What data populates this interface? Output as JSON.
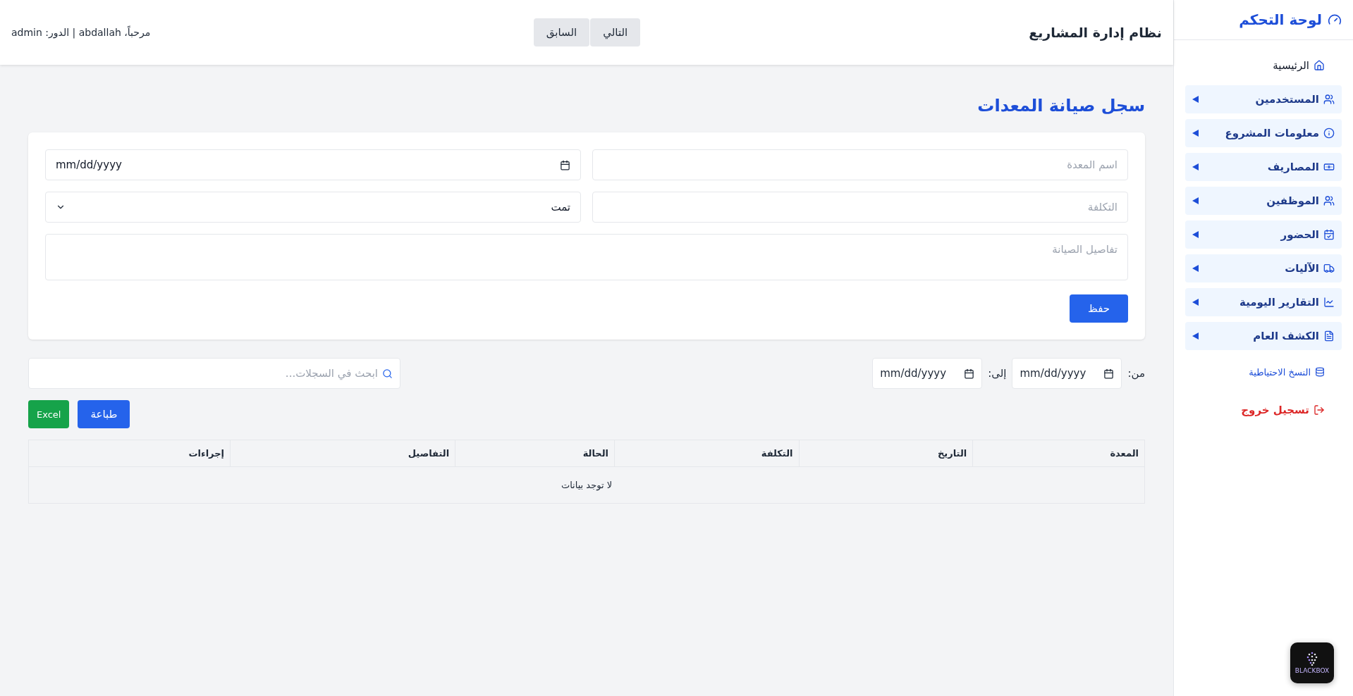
{
  "sidebar": {
    "title": "لوحة التحكم",
    "items": [
      {
        "kind": "home",
        "label": "الرئيسية"
      },
      {
        "kind": "group",
        "label": "المستخدمين",
        "expanded": false
      },
      {
        "kind": "group",
        "label": "معلومات المشروع",
        "expanded": false
      },
      {
        "kind": "group",
        "label": "المصاريف",
        "expanded": false
      },
      {
        "kind": "group",
        "label": "الموظفين",
        "expanded": false
      },
      {
        "kind": "group",
        "label": "الحضور",
        "expanded": false
      },
      {
        "kind": "group",
        "label": "الآليات",
        "expanded": false
      },
      {
        "kind": "group",
        "label": "التقارير اليومية",
        "expanded": false
      },
      {
        "kind": "group",
        "label": "الكشف العام",
        "expanded": false
      },
      {
        "kind": "link",
        "label": "النسخ الاحتياطية"
      },
      {
        "kind": "danger",
        "label": "تسجيل خروج"
      }
    ]
  },
  "header": {
    "title": "نظام إدارة المشاريع",
    "nav_buttons": [
      "التالي",
      "السابق"
    ],
    "user_info": "مرحباً، abdallah | الدور: admin"
  },
  "page_title": "سجل صيانة المعدات",
  "form": {
    "equipment_name": {
      "placeholder": "اسم المعدة"
    },
    "date": {
      "placeholder": "mm/dd/yyyy"
    },
    "cost": {
      "placeholder": "التكلفة"
    },
    "status": {
      "value": "تمت"
    },
    "details": {
      "placeholder": "تفاصيل الصيانة"
    },
    "save_button": "حفظ"
  },
  "filters": {
    "from_label": "من:",
    "from_date": {
      "placeholder": "mm/dd/yyyy"
    },
    "to_label": "إلى:",
    "to_date": {
      "placeholder": "mm/dd/yyyy"
    },
    "search": {
      "placeholder": "ابحث في السجلات..."
    }
  },
  "actions": {
    "print_button": "طباعة",
    "excel_button": "Excel"
  },
  "table": {
    "columns": [
      "المعدة",
      "التاريخ",
      "التكلفة",
      "الحالة",
      "التفاصيل",
      "إجراءات"
    ],
    "empty_message": "لا توجد بيانات"
  },
  "widget": {
    "label": "BLACKBOX"
  }
}
